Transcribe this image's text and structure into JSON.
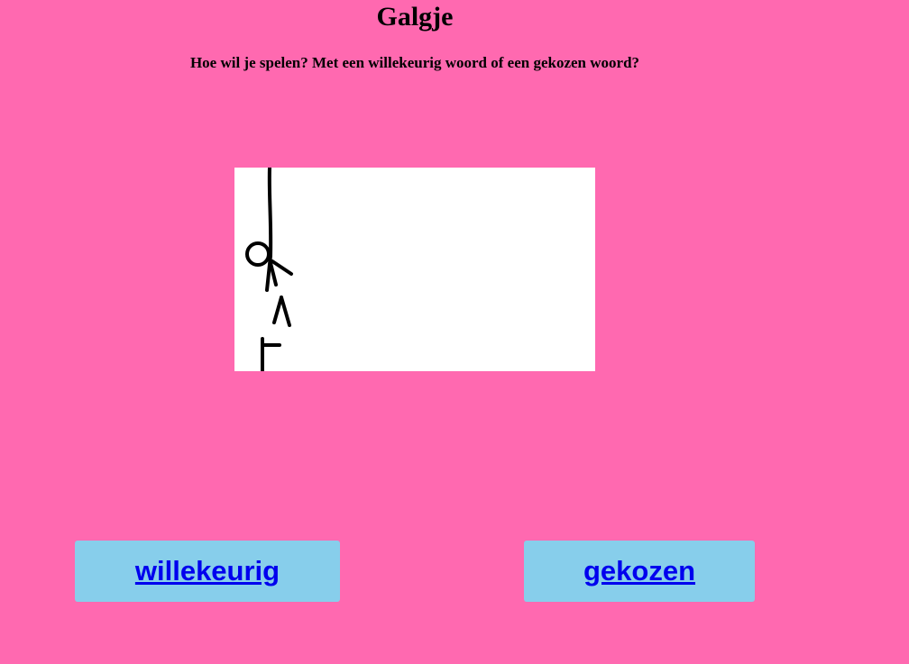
{
  "page": {
    "title": "Galgje",
    "question": "Hoe wil je spelen? Met een willekeurig woord of een gekozen woord?",
    "background_color": "#ff69b0"
  },
  "illustration": {
    "icon": "hangman-figure-icon"
  },
  "buttons": {
    "random_label": "willekeurig",
    "chosen_label": "gekozen",
    "button_color": "#87ceeb",
    "link_color": "#0000ee"
  }
}
